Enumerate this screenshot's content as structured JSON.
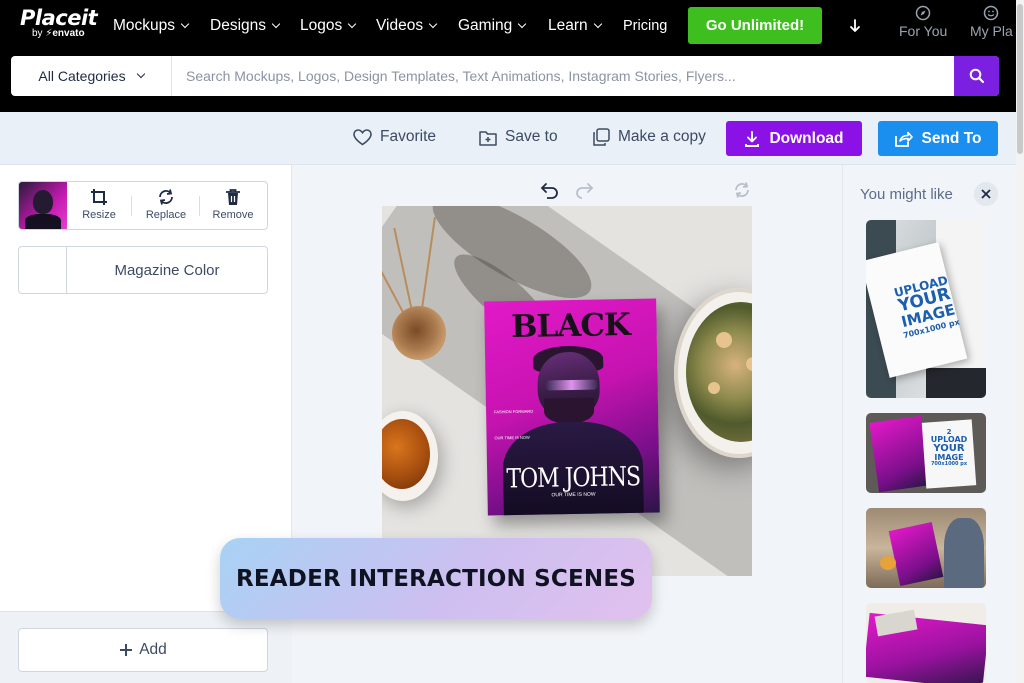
{
  "brand": {
    "logo": "Placeit",
    "by": "by",
    "envato": "envato"
  },
  "nav": {
    "items": [
      "Mockups",
      "Designs",
      "Logos",
      "Videos",
      "Gaming",
      "Learn"
    ],
    "pricing": "Pricing",
    "cta": "Go Unlimited!",
    "for_you": "For You",
    "my_place": "My Pla"
  },
  "search": {
    "category": "All Categories",
    "placeholder": "Search Mockups, Logos, Design Templates, Text Animations, Instagram Stories, Flyers..."
  },
  "toolbar": {
    "favorite": "Favorite",
    "save_to": "Save to",
    "make_copy": "Make a copy",
    "download": "Download",
    "send_to": "Send To"
  },
  "editor": {
    "resize": "Resize",
    "replace": "Replace",
    "remove": "Remove",
    "color_label": "Magazine Color",
    "add": "Add"
  },
  "magazine": {
    "title": "BLACK",
    "name": "TOM JOHNS",
    "tagline": "OUR TIME IS NOW",
    "side_1": "FASHION FORWARD",
    "side_2": "OUR TIME IS NOW"
  },
  "overlay": {
    "label": "READER INTERACTION SCENES"
  },
  "sidebar": {
    "title": "You might like",
    "upload_1": [
      "UPLOAD",
      "YOUR",
      "IMAGE",
      "700x1000 px"
    ],
    "upload_2": [
      "2",
      "UPLOAD",
      "YOUR",
      "IMAGE",
      "700x1000 px"
    ]
  },
  "colors": {
    "brand_green": "#3fbf1f",
    "download_purple": "#8a12e6",
    "send_blue": "#1a8ff0",
    "search_purple": "#7b1fe0",
    "magazine_magenta": "#c613b0"
  }
}
